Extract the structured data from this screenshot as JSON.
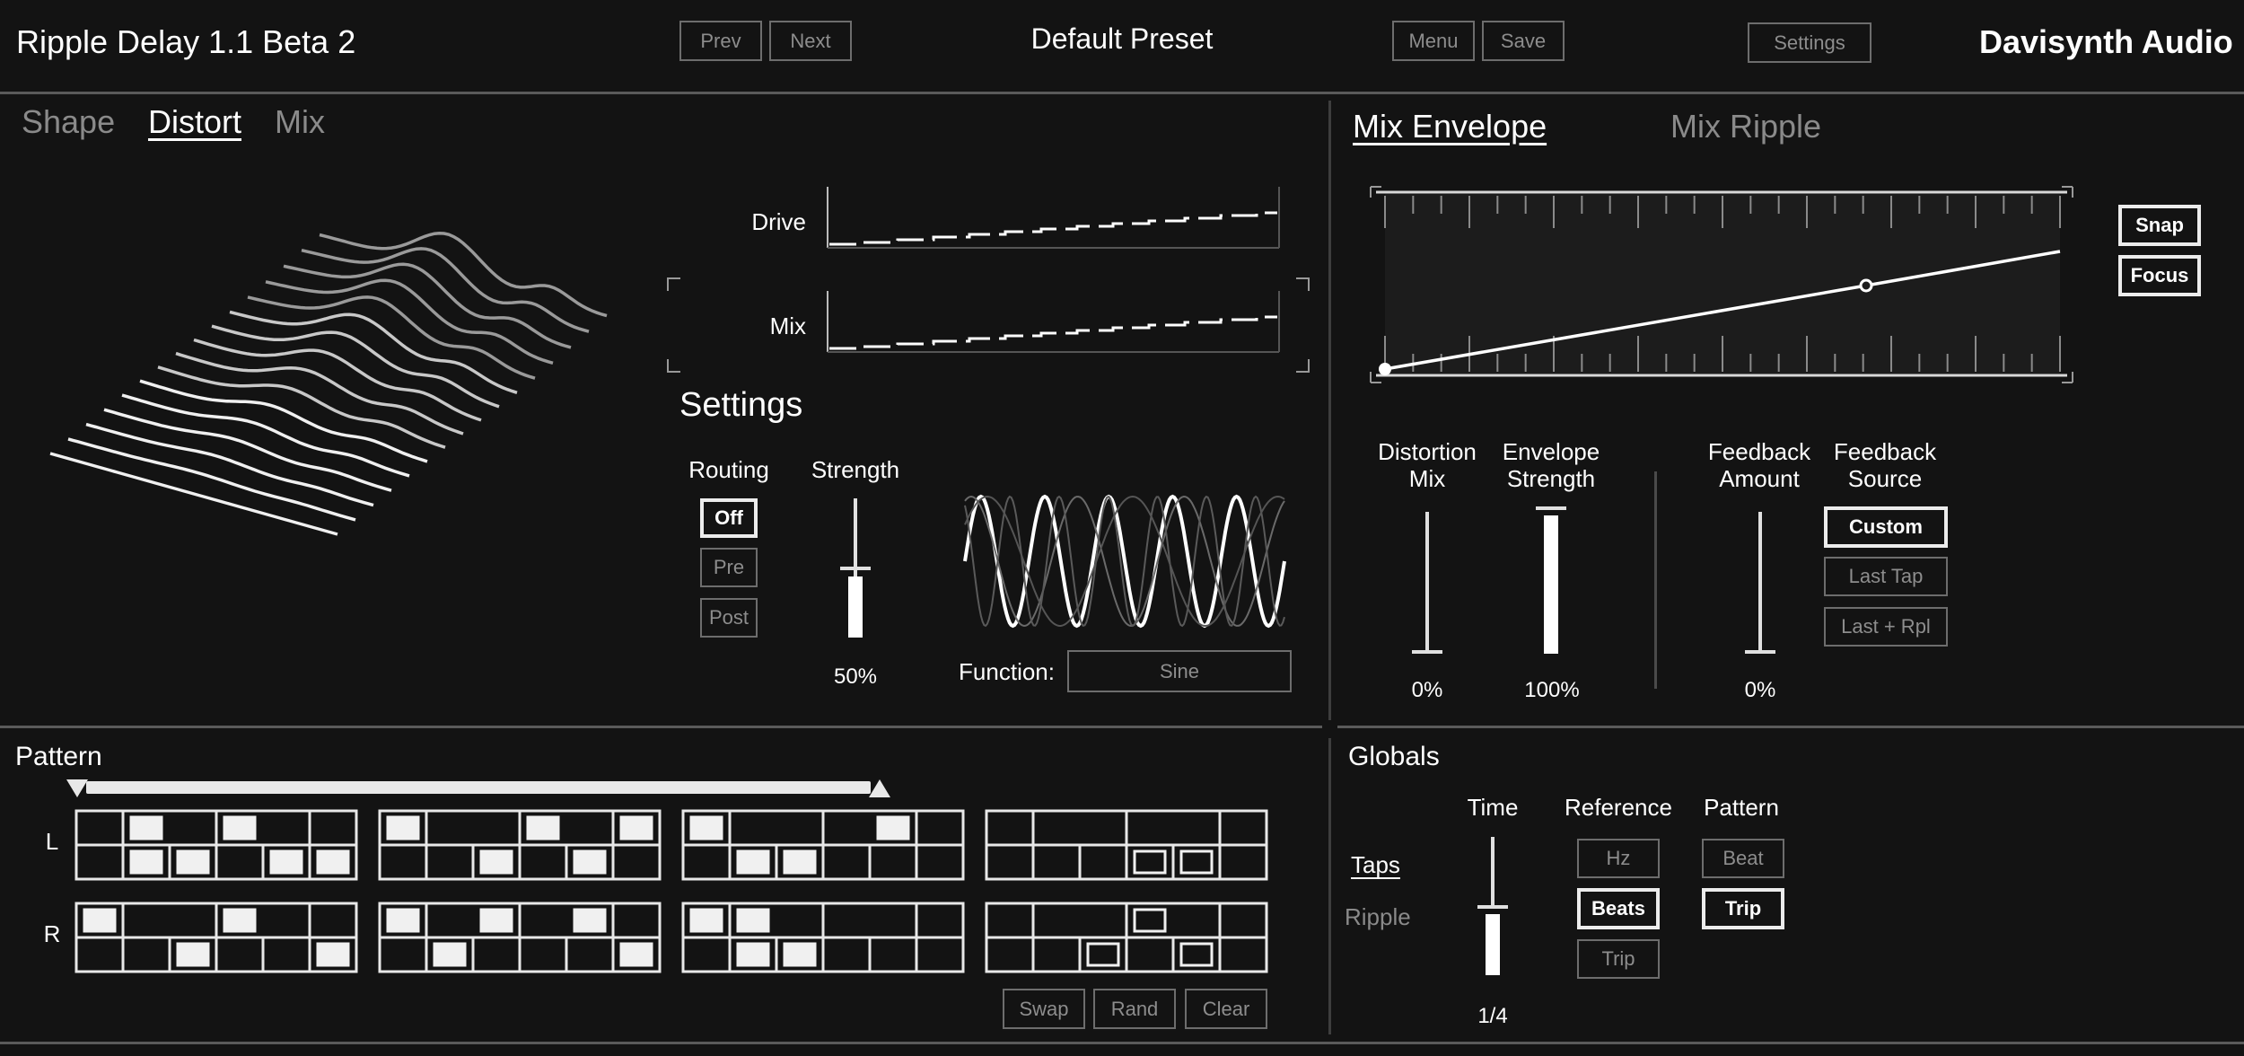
{
  "header": {
    "app_title": "Ripple Delay 1.1 Beta 2",
    "prev_label": "Prev",
    "next_label": "Next",
    "preset_name": "Default Preset",
    "menu_label": "Menu",
    "save_label": "Save",
    "settings_label": "Settings",
    "brand": "Davisynth Audio"
  },
  "left_tabs": [
    {
      "label": "Shape",
      "active": false
    },
    {
      "label": "Distort",
      "active": true
    },
    {
      "label": "Mix",
      "active": false
    }
  ],
  "distort": {
    "drive_label": "Drive",
    "mix_label": "Mix",
    "settings_heading": "Settings",
    "routing_label": "Routing",
    "routing_options": [
      "Off",
      "Pre",
      "Post"
    ],
    "routing_selected": "Off",
    "strength_label": "Strength",
    "strength_value": "50%",
    "strength_level": 0.5,
    "function_label": "Function:",
    "function_value": "Sine"
  },
  "right_tabs": [
    {
      "label": "Mix Envelope",
      "active": true
    },
    {
      "label": "Mix Ripple",
      "active": false
    }
  ],
  "envelope": {
    "snap_label": "Snap",
    "focus_label": "Focus",
    "distortion_mix_label": "Distortion\nMix",
    "distortion_mix_value": "0%",
    "distortion_mix_level": 0.0,
    "envelope_strength_label": "Envelope\nStrength",
    "envelope_strength_value": "100%",
    "envelope_strength_level": 1.0,
    "feedback_amount_label": "Feedback\nAmount",
    "feedback_amount_value": "0%",
    "feedback_amount_level": 0.0,
    "feedback_source_label": "Feedback\nSource",
    "feedback_source_options": [
      "Custom",
      "Last Tap",
      "Last + Rpl"
    ],
    "feedback_source_selected": "Custom"
  },
  "pattern": {
    "heading": "Pattern",
    "row_labels": [
      "L",
      "R"
    ],
    "swap_label": "Swap",
    "rand_label": "Rand",
    "clear_label": "Clear"
  },
  "globals": {
    "heading": "Globals",
    "taps_label": "Taps",
    "ripple_label": "Ripple",
    "time_label": "Time",
    "time_value": "1/4",
    "time_level": 0.5,
    "reference_label": "Reference",
    "reference_options": [
      "Hz",
      "Beats",
      "Trip"
    ],
    "reference_selected": "Beats",
    "pattern_label": "Pattern",
    "pattern_options": [
      "Beat",
      "Trip"
    ],
    "pattern_selected": "Trip"
  },
  "colors": {
    "background": "#131313",
    "active": "#ffffff",
    "inactive": "#8a8a8a",
    "divider": "#5a5a5a"
  }
}
